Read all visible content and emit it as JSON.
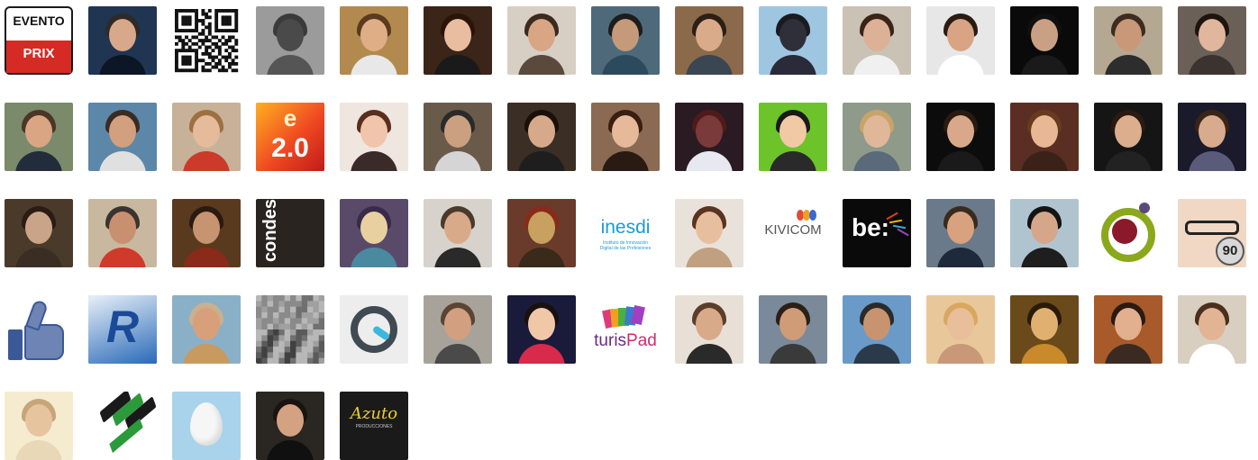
{
  "avatars": [
    {
      "kind": "evento",
      "icon": "evento-prix-logo-icon",
      "text": "EVENTO",
      "text2": "PRIX",
      "bg": "#ffffff"
    },
    {
      "kind": "photo",
      "icon": "man-suit-photo-icon",
      "bg": "#1f3552",
      "skin": "#d8a88a",
      "hair": "#2e2a28",
      "body": "#0c1624"
    },
    {
      "kind": "qr",
      "icon": "qr-code-icon",
      "bg": "#ffffff"
    },
    {
      "kind": "photo",
      "icon": "silhouette-photo-icon",
      "bg": "#9b9b9b",
      "skin": "#4a4a4a",
      "hair": "#3a3a3a",
      "body": "#555555"
    },
    {
      "kind": "photo",
      "icon": "man-smiling-photo-icon",
      "bg": "#b28a4f",
      "skin": "#e0ae86",
      "hair": "#5b3a1f",
      "body": "#e8e8e8"
    },
    {
      "kind": "photo",
      "icon": "woman-smiling-photo-icon",
      "bg": "#3b2418",
      "skin": "#e8bda0",
      "hair": "#2a140a",
      "body": "#1a1a1a"
    },
    {
      "kind": "photo",
      "icon": "man-portrait-photo-icon",
      "bg": "#d8cfc4",
      "skin": "#d8a585",
      "hair": "#3b2a20",
      "body": "#5a4a3e"
    },
    {
      "kind": "photo",
      "icon": "people-table-photo-icon",
      "bg": "#4e6a7a",
      "skin": "#c49a7a",
      "hair": "#1d1d1d",
      "body": "#2c4a5e"
    },
    {
      "kind": "photo",
      "icon": "man-glasses-photo-icon",
      "bg": "#8a6a4a",
      "skin": "#d9ab8b",
      "hair": "#2b1f16",
      "body": "#3a4652"
    },
    {
      "kind": "photo",
      "icon": "person-beach-photo-icon",
      "bg": "#9fc6e0",
      "skin": "#2f2f3a",
      "hair": "#1a1a22",
      "body": "#2a2a38"
    },
    {
      "kind": "photo",
      "icon": "woman-dark-hair-photo-icon",
      "bg": "#c9c2b5",
      "skin": "#dcb195",
      "hair": "#3a2417",
      "body": "#f0f0f0"
    },
    {
      "kind": "photo",
      "icon": "man-smiling-white-photo-icon",
      "bg": "#e7e7e7",
      "skin": "#d8a484",
      "hair": "#2b1c12",
      "body": "#ffffff"
    },
    {
      "kind": "photo",
      "icon": "man-beard-photo-icon",
      "bg": "#0a0a0a",
      "skin": "#caa084",
      "hair": "#101010",
      "body": "#1a1a1a"
    },
    {
      "kind": "photo",
      "icon": "man-room-photo-icon",
      "bg": "#b5a892",
      "skin": "#c99878",
      "hair": "#3d2c20",
      "body": "#2d2d2d"
    },
    {
      "kind": "photo",
      "icon": "woman-long-hair-photo-icon",
      "bg": "#6b6058",
      "skin": "#e0b79c",
      "hair": "#1e140e",
      "body": "#3a3330"
    },
    {
      "kind": "photo",
      "icon": "man-outdoor-photo-icon",
      "bg": "#7a8a6a",
      "skin": "#d9a583",
      "hair": "#4a3626",
      "body": "#222c3a"
    },
    {
      "kind": "photo",
      "icon": "man-harbor-photo-icon",
      "bg": "#5d87a8",
      "skin": "#d2a07e",
      "hair": "#3a2c22",
      "body": "#e0e0e0"
    },
    {
      "kind": "photo",
      "icon": "woman-blonde-photo-icon",
      "bg": "#c7b199",
      "skin": "#e5bb9b",
      "hair": "#9c7040",
      "body": "#cc3a2a"
    },
    {
      "kind": "e20",
      "icon": "e20-logo-icon",
      "text": "e",
      "text2": "2.0",
      "bg": "#ef4a22"
    },
    {
      "kind": "photo",
      "icon": "woman-smiling-brown-photo-icon",
      "bg": "#efe6e0",
      "skin": "#f0c5ab",
      "hair": "#5a2e1c",
      "body": "#3a2a2a"
    },
    {
      "kind": "photo",
      "icon": "man-laptop-photo-icon",
      "bg": "#6a5a4a",
      "skin": "#caa080",
      "hair": "#2a2a2a",
      "body": "#d5d5d5"
    },
    {
      "kind": "photo",
      "icon": "woman-dark-photo-icon",
      "bg": "#3a2e25",
      "skin": "#d6a98a",
      "hair": "#1a100a",
      "body": "#1e1e1e"
    },
    {
      "kind": "photo",
      "icon": "woman-brunette-photo-icon",
      "bg": "#8a6a52",
      "skin": "#e5b99a",
      "hair": "#3a1e10",
      "body": "#2a1a14"
    },
    {
      "kind": "photo",
      "icon": "night-lights-photo-icon",
      "bg": "#2a1a22",
      "skin": "#7a3a3a",
      "hair": "#501a1a",
      "body": "#e8e8f0"
    },
    {
      "kind": "photo",
      "icon": "cartoon-avatar-photo-icon",
      "bg": "#6cc42a",
      "skin": "#f2c9a5",
      "hair": "#1a1a1a",
      "body": "#2a2a2a"
    },
    {
      "kind": "photo",
      "icon": "woman-blonde-profile-photo-icon",
      "bg": "#8f9a8a",
      "skin": "#e1b799",
      "hair": "#c7a46a",
      "body": "#5a6a7a"
    },
    {
      "kind": "photo",
      "icon": "woman-dark-bg-photo-icon",
      "bg": "#0c0c0c",
      "skin": "#d9a88a",
      "hair": "#2a1a10",
      "body": "#1a1a1a"
    },
    {
      "kind": "photo",
      "icon": "woman-looking-up-photo-icon",
      "bg": "#5a2e22",
      "skin": "#e8b895",
      "hair": "#6a3a1e",
      "body": "#3a2218"
    },
    {
      "kind": "photo",
      "icon": "woman-smiling-dark-photo-icon",
      "bg": "#151515",
      "skin": "#dcae8e",
      "hair": "#2a1a12",
      "body": "#222222"
    },
    {
      "kind": "photo",
      "icon": "woman-curly-hair-photo-icon",
      "bg": "#1a1a2a",
      "skin": "#d8aa8e",
      "hair": "#3a2416",
      "body": "#5a5a7a"
    },
    {
      "kind": "photo",
      "icon": "woman-close-up-photo-icon",
      "bg": "#4a3a2a",
      "skin": "#caa488",
      "hair": "#2a1c14",
      "body": "#3a2e24"
    },
    {
      "kind": "photo",
      "icon": "man-older-photo-icon",
      "bg": "#c8b8a0",
      "skin": "#c99070",
      "hair": "#3a3430",
      "body": "#d03a2a"
    },
    {
      "kind": "photo",
      "icon": "man-seated-photo-icon",
      "bg": "#5a3a1e",
      "skin": "#c69470",
      "hair": "#2a1a10",
      "body": "#8a2a1a"
    },
    {
      "kind": "condes",
      "icon": "condes-logo-icon",
      "text": "condes",
      "bg": "#2a2420"
    },
    {
      "kind": "photo",
      "icon": "concert-stage-photo-icon",
      "bg": "#5a4a6a",
      "skin": "#e8d0a0",
      "hair": "#3a2a4a",
      "body": "#4a8aa0"
    },
    {
      "kind": "photo",
      "icon": "man-bald-smile-photo-icon",
      "bg": "#d7d3cc",
      "skin": "#d8aa8a",
      "hair": "#4a3a2c",
      "body": "#2a2a2a"
    },
    {
      "kind": "photo",
      "icon": "food-market-photo-icon",
      "bg": "#6a3a2a",
      "skin": "#c8a060",
      "hair": "#8a2a1a",
      "body": "#3a2a1a"
    },
    {
      "kind": "inesdi",
      "icon": "inesdi-logo-icon",
      "text": "inesdi",
      "text2": "Instituto de Innovación Digital de las Profesiones",
      "bg": "#ffffff"
    },
    {
      "kind": "photo",
      "icon": "woman-light-photo-icon",
      "bg": "#e8e2da",
      "skin": "#e7bf9f",
      "hair": "#5a3420",
      "body": "#c0a080"
    },
    {
      "kind": "kivicom",
      "icon": "kivicom-logo-icon",
      "text": "KIVICOM",
      "bg": "#ffffff"
    },
    {
      "kind": "be",
      "icon": "be-logo-icon",
      "text": "be:",
      "bg": "#0a0a0a"
    },
    {
      "kind": "photo",
      "icon": "man-laughing-photo-icon",
      "bg": "#6a7a8a",
      "skin": "#d9a27e",
      "hair": "#3a2a1e",
      "body": "#1e2a3a"
    },
    {
      "kind": "photo",
      "icon": "woman-sunglasses-photo-icon",
      "bg": "#b0c4d0",
      "skin": "#d5a68a",
      "hair": "#141414",
      "body": "#1e1e1e"
    },
    {
      "kind": "ring",
      "icon": "ring-person-logo-icon",
      "bg": "#ffffff"
    },
    {
      "kind": "glasses90",
      "icon": "glasses-90-photo-icon",
      "text": "90",
      "bg": "#e8e8e8"
    },
    {
      "kind": "thumbs",
      "icon": "thumbs-up-icon",
      "bg": "#ffffff"
    },
    {
      "kind": "rlogo",
      "icon": "r-logo-icon",
      "text": "R",
      "bg": "#2a6ab8"
    },
    {
      "kind": "photo",
      "icon": "man-cap-photo-icon",
      "bg": "#8ab0c8",
      "skin": "#d8a07a",
      "hair": "#c8b090",
      "body": "#c89a60"
    },
    {
      "kind": "pixel",
      "icon": "pixelated-photo-icon",
      "bg": "#9a9a9a"
    },
    {
      "kind": "oring",
      "icon": "o-ring-logo-icon",
      "bg": "#ededed"
    },
    {
      "kind": "photo",
      "icon": "man-gray-photo-icon",
      "bg": "#a8a39a",
      "skin": "#d2a080",
      "hair": "#5a4434",
      "body": "#4a4a4a"
    },
    {
      "kind": "photo",
      "icon": "woman-balloons-photo-icon",
      "bg": "#1a1a3a",
      "skin": "#f0c8a8",
      "hair": "#1a1010",
      "body": "#d82a4a"
    },
    {
      "kind": "turispad",
      "icon": "turispad-logo-icon",
      "text": "turis",
      "text2": "Pad",
      "bg": "#ffffff"
    },
    {
      "kind": "photo",
      "icon": "woman-sunglasses-head-photo-icon",
      "bg": "#e8e0d6",
      "skin": "#d8aa8a",
      "hair": "#5a3e2a",
      "body": "#2a2a2a"
    },
    {
      "kind": "photo",
      "icon": "man-terrace-photo-icon",
      "bg": "#7a8a9a",
      "skin": "#d09c78",
      "hair": "#2a2018",
      "body": "#3a3a3a"
    },
    {
      "kind": "photo",
      "icon": "man-sunglasses-sky-photo-icon",
      "bg": "#6a9ac8",
      "skin": "#c89470",
      "hair": "#2a2a2a",
      "body": "#2a3a4a"
    },
    {
      "kind": "photo",
      "icon": "woman-blonde-sun-photo-icon",
      "bg": "#e8c89a",
      "skin": "#e8bf9a",
      "hair": "#d8a860",
      "body": "#c89878"
    },
    {
      "kind": "photo",
      "icon": "woman-yellow-light-photo-icon",
      "bg": "#6a4a1a",
      "skin": "#e0b070",
      "hair": "#2a1a0a",
      "body": "#c88a2a"
    },
    {
      "kind": "photo",
      "icon": "woman-restaurant-photo-icon",
      "bg": "#a85a2a",
      "skin": "#e2b08e",
      "hair": "#2a1a12",
      "body": "#3a2a22"
    },
    {
      "kind": "photo",
      "icon": "woman-smiling-light-photo-icon",
      "bg": "#d8cfc0",
      "skin": "#e2b494",
      "hair": "#4a2e1e",
      "body": "#ffffff"
    },
    {
      "kind": "photo",
      "icon": "woman-sepia-photo-icon",
      "bg": "#f5ecd0",
      "skin": "#e6c49e",
      "hair": "#c8a47a",
      "body": "#e8d8b8"
    },
    {
      "kind": "ecologo",
      "icon": "green-stripes-logo-icon",
      "bg": "#ffffff"
    },
    {
      "kind": "egg",
      "icon": "default-egg-avatar-icon",
      "bg": "#a8d3ea"
    },
    {
      "kind": "photo",
      "icon": "man-glasses-dark-photo-icon",
      "bg": "#2a2622",
      "skin": "#d4a282",
      "hair": "#1a1410",
      "body": "#101010"
    },
    {
      "kind": "azuto",
      "icon": "azuto-logo-icon",
      "text": "Azuto",
      "text2": "PRODUCCIONES",
      "bg": "#1a1a1a"
    }
  ]
}
